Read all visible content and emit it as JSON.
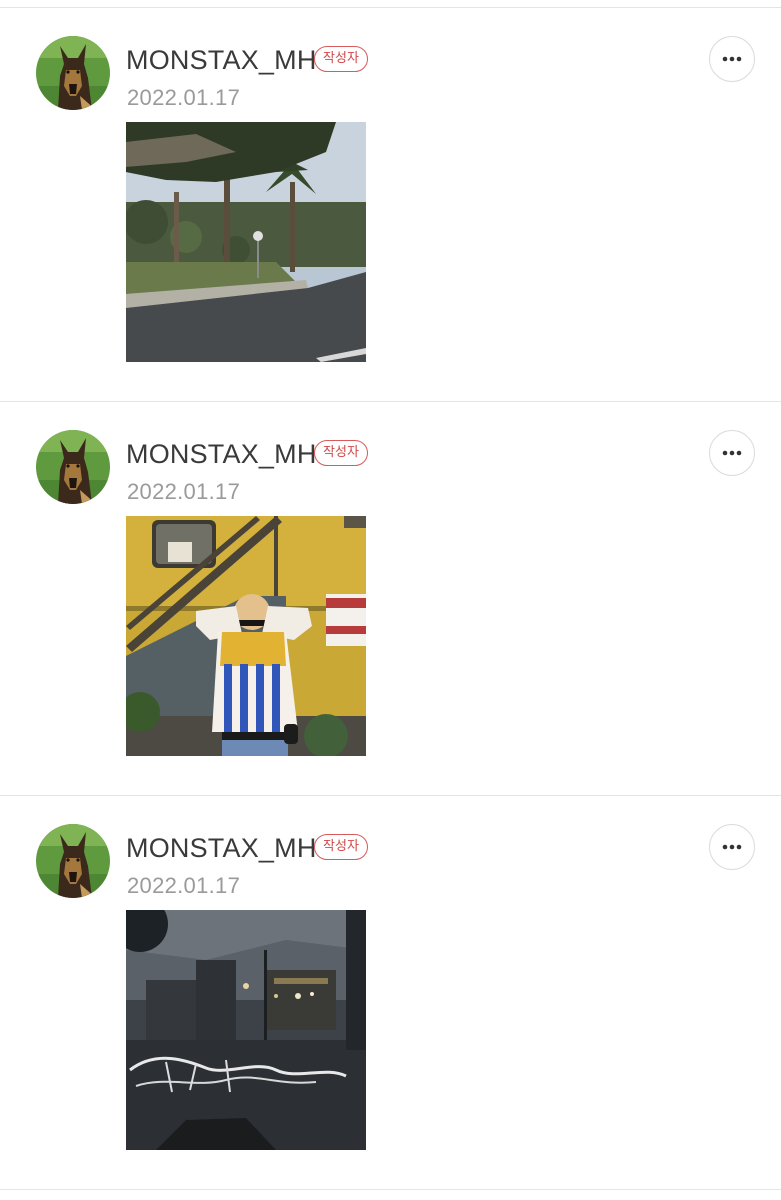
{
  "posts": [
    {
      "username": "MONSTAX_MH",
      "badge": "작성자",
      "date": "2022.01.17",
      "photo_icon": "street-palm-trees-photo"
    },
    {
      "username": "MONSTAX_MH",
      "badge": "작성자",
      "date": "2022.01.17",
      "photo_icon": "person-yellow-trailer-photo"
    },
    {
      "username": "MONSTAX_MH",
      "badge": "작성자",
      "date": "2022.01.17",
      "photo_icon": "night-window-reflection-photo"
    }
  ],
  "colors": {
    "badge_red": "#d04848",
    "divider": "#e4e4e4",
    "username": "#3a3a3a",
    "date": "#9a9a9a"
  }
}
